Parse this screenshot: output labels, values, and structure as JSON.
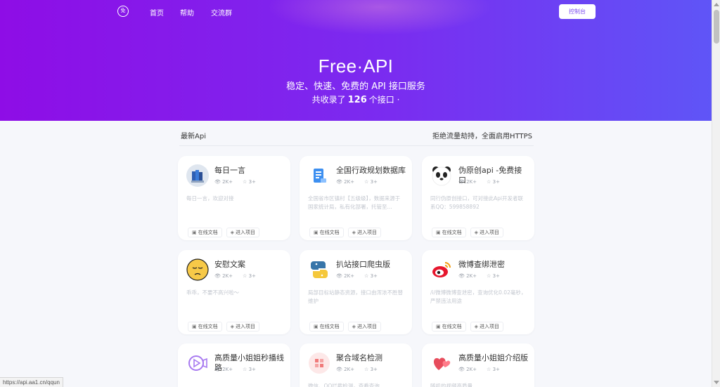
{
  "nav": {
    "logo_text": "免",
    "links": [
      "首页",
      "帮助",
      "交流群"
    ],
    "console_label": "控制台"
  },
  "hero": {
    "title": "Free·API",
    "subtitle": "稳定、快速、免费的 API 接口服务",
    "count_prefix": "共收录了",
    "count": "126",
    "count_suffix": "个接口 ·"
  },
  "section": {
    "left": "最新Api",
    "right": "拒绝流量劫持，全面启用HTTPS"
  },
  "card_buttons": {
    "docs": "在线文档",
    "project": "进入项目",
    "docs_icon": "▣",
    "project_icon": "◈"
  },
  "cards": [
    {
      "title": "每日一言",
      "views": "2K+",
      "stars": "3+",
      "desc": "每日一言，欢迎对接",
      "icon": "books-icon"
    },
    {
      "title": "全国行政规划数据库",
      "views": "2K+",
      "stars": "3+",
      "desc": "全国省市区镇村【五级级】，数据来源于国家统计局，私有化部署，托管至...",
      "icon": "document-icon"
    },
    {
      "title": "伪原创api -免费接口",
      "views": "2K+",
      "stars": "3+",
      "desc": "同行伪原创接口，可对接此Api开发者联系QQ：599858892",
      "icon": "panda-icon"
    },
    {
      "title": "安慰文案",
      "views": "2K+",
      "stars": "3+",
      "desc": "乖乖，不要不高兴啦～",
      "icon": "pensive-face-icon"
    },
    {
      "title": "扒站接口爬虫版",
      "views": "2K+",
      "stars": "3+",
      "desc": "局部目标站静态资源，接口由浑浓不胜替维护",
      "icon": "python-icon"
    },
    {
      "title": "微博查绑泄密",
      "views": "2K+",
      "stars": "3+",
      "desc": "/i/微博微博查泄密，查询优化0.02毫秒，严禁违法用途",
      "icon": "weibo-icon"
    },
    {
      "title": "高质量小姐姐秒播线路",
      "views": "2K+",
      "stars": "3+",
      "desc": "",
      "icon": "video-icon"
    },
    {
      "title": "聚合域名检测",
      "views": "2K+",
      "stars": "3+",
      "desc": "微信、QQ拦截检测，查看查询",
      "icon": "grid-icon"
    },
    {
      "title": "高质量小姐姐介绍版",
      "views": "2K+",
      "stars": "3+",
      "desc": "随机的视频高质量",
      "icon": "hearts-icon"
    }
  ],
  "colors": {
    "hero_start": "#8e0de6",
    "hero_end": "#5f55f7",
    "accent": "#7b4af0"
  },
  "statusbar": "https://api.aa1.cn/qqun"
}
